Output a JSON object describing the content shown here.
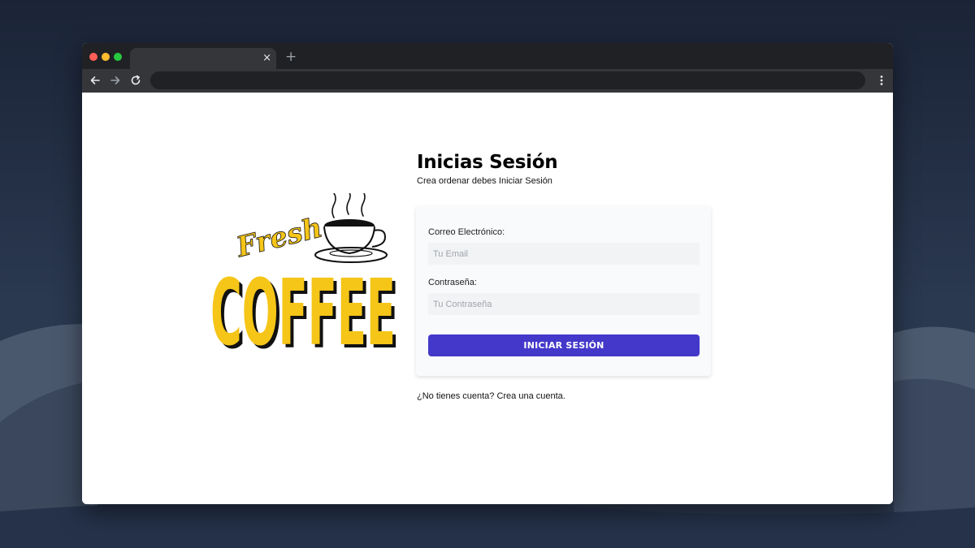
{
  "browser": {
    "tab_close": "×",
    "new_tab": "+"
  },
  "logo": {
    "text_top": "Fresh",
    "text_main": "COFFEE",
    "accent_color": "#f5c518"
  },
  "login": {
    "title": "Inicias Sesión",
    "subtitle": "Crea ordenar debes Iniciar Sesión",
    "email_label": "Correo Electrónico:",
    "email_placeholder": "Tu Email",
    "password_label": "Contraseña:",
    "password_placeholder": "Tu Contraseña",
    "submit_label": "Iniciar Sesión",
    "register_link": "¿No tienes cuenta? Crea una cuenta.",
    "button_color": "#4338ca"
  },
  "icons": {
    "back": "arrow-left-icon",
    "forward": "arrow-right-icon",
    "reload": "reload-icon",
    "menu": "more-vert-icon"
  }
}
